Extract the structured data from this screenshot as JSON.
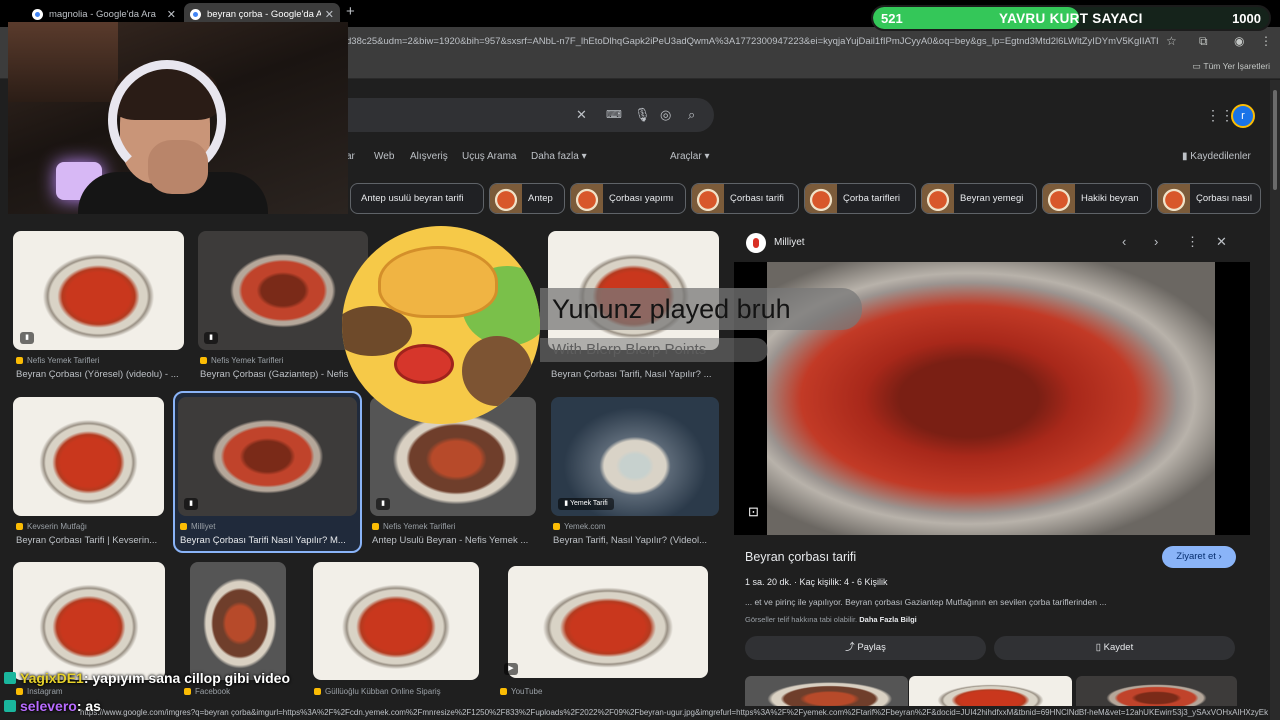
{
  "tabs": [
    {
      "label": "magnolia - Google'da Ara",
      "active": false
    },
    {
      "label": "beyran çorba - Google'da Ara",
      "active": true
    }
  ],
  "address_bar": {
    "url": "d38c25&udm=2&biw=1920&bih=957&sxsrf=ANbL-n7F_lhEtoDlhqGapk2iPeU3adQwmA%3A1772300947223&ei=kyqjaYujDail1fIPmJCyyA0&oq=bey&gs_lp=Egtnd3Mtd2l6LWltZyIDYmV5KgIIATIK..."
  },
  "bookmarks": {
    "all_label": "Tüm Yer İşaretleri"
  },
  "counter": {
    "current": "521",
    "label": "YAVRU KURT SAYACI",
    "max": "1000",
    "fraction": 0.521,
    "color": "#34c759"
  },
  "search": {
    "nav": [
      "ar",
      "Web",
      "Alışveriş",
      "Uçuş Arama",
      "Daha fazla ▾"
    ],
    "tools": "Araçlar ▾",
    "saved": "Kaydedilenler",
    "account_initial": "r",
    "chips": [
      "Antep usulü beyran tarifi",
      "Antep",
      "Çorbası yapımı",
      "Çorbası tarifi",
      "Çorba tarifleri",
      "Beyran yemegi",
      "Hakiki beyran",
      "Çorbası nasıl"
    ]
  },
  "results": [
    {
      "source": "Nefis Yemek Tarifleri",
      "title": "Beyran Çorbası (Yöresel) (videolu) - ..."
    },
    {
      "source": "Nefis Yemek Tarifleri",
      "title": "Beyran Çorbası (Gaziantep) - Nefis"
    },
    {
      "source": "",
      "title": "Beyran Çorbası Tarifi, Nasıl Yapılır? ..."
    },
    {
      "source": "Kevserin Mutfağı",
      "title": "Beyran Çorbası Tarifi | Kevserin..."
    },
    {
      "source": "Milliyet",
      "title": "Beyran Çorbası Tarifi Nasıl Yapılır? M..."
    },
    {
      "source": "Nefis Yemek Tarifleri",
      "title": "Antep Usulü Beyran - Nefis Yemek ..."
    },
    {
      "source": "Yemek.com",
      "title": "Beyran Tarifi, Nasıl Yapılır? (Videol..."
    },
    {
      "source": "Instagram",
      "title": ""
    },
    {
      "source": "Facebook",
      "title": ""
    },
    {
      "source": "Güllüoğlu Kübban Online Sipariş",
      "title": ""
    },
    {
      "source": "YouTube",
      "title": ""
    }
  ],
  "thumb_labels": {
    "yemek_tarifi": "Yemek Tarifi"
  },
  "panel": {
    "site": "Milliyet",
    "title": "Beyran çorbası tarifi",
    "visit": "Ziyaret et ›",
    "duration": "1 sa. 20 dk.",
    "servings": "Kaç kişilik: 4 - 6 Kişilik",
    "description": "... et ve pirinç ile yapılıyor. Beyran çorbası Gaziantep Mutfağının en sevilen çorba tariflerinden ...",
    "copyright": "Görseller telif hakkına tabi olabilir.",
    "more_info": "Daha Fazla Bilgi",
    "share": "Paylaş",
    "save": "Kaydet"
  },
  "alert": {
    "title": "Yununz played bruh",
    "subtitle": "With Blerp Blerp Points"
  },
  "chat": [
    {
      "user": "YagixDE1",
      "message": ": yapıyım sana cillop gibi video"
    },
    {
      "user": "selevero",
      "message": ": as"
    }
  ],
  "status_url": "https://www.google.com/imgres?q=beyran çorba&imgurl=https%3A%2F%2Fcdn.yemek.com%2Fmnresize%2F1250%2F833%2Fuploads%2F2022%2F09%2Fbeyran-ugur.jpg&imgrefurl=https%3A%2F%2Fyemek.com%2Ftarif%2Fbeyran%2F&docid=JUI42hihdfxxM&tbnid=69HNClNdBf-heM&vet=12ahUKEwirr53j3_ySAxVOHxAIHXzyEkEQnPAOegQILRAB.i..."
}
